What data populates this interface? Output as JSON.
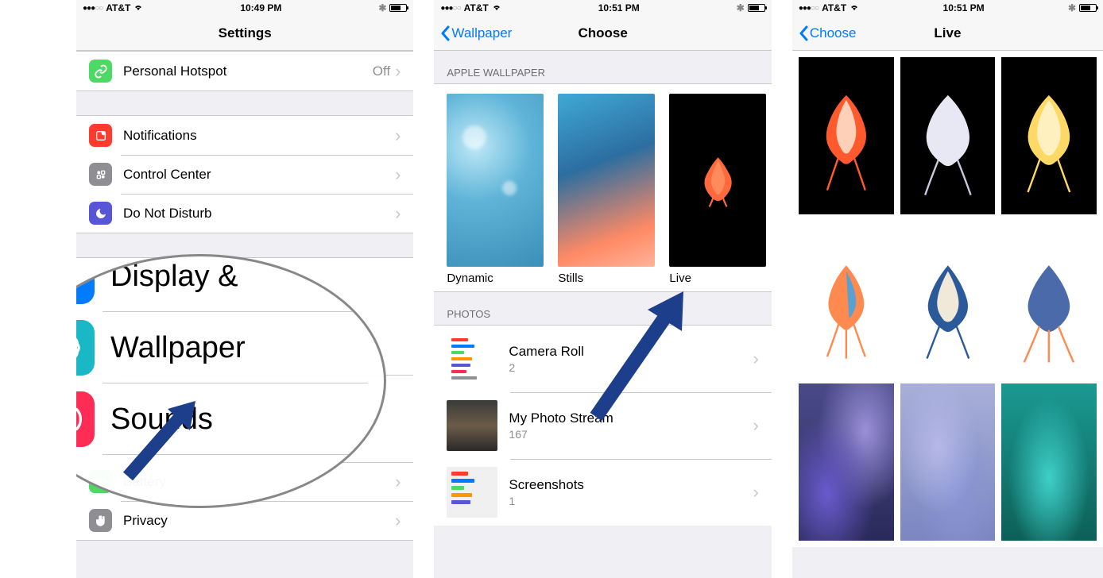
{
  "screen1": {
    "status": {
      "carrier": "AT&T",
      "time": "10:49 PM"
    },
    "title": "Settings",
    "hotspot": {
      "label": "Personal Hotspot",
      "value": "Off"
    },
    "notifications": "Notifications",
    "controlCenter": "Control Center",
    "dnd": "Do Not Disturb",
    "display": "Display &",
    "wallpaper": "Wallpaper",
    "sounds": "Sounds",
    "battery": "Battery",
    "privacy": "Privacy"
  },
  "screen2": {
    "status": {
      "carrier": "AT&T",
      "time": "10:51 PM"
    },
    "back": "Wallpaper",
    "title": "Choose",
    "sectionApple": "APPLE WALLPAPER",
    "dynamic": "Dynamic",
    "stills": "Stills",
    "live": "Live",
    "sectionPhotos": "PHOTOS",
    "cameraRoll": {
      "title": "Camera Roll",
      "count": "2"
    },
    "myStream": {
      "title": "My Photo Stream",
      "count": "167"
    },
    "screenshots": {
      "title": "Screenshots",
      "count": "1"
    }
  },
  "screen3": {
    "status": {
      "carrier": "AT&T",
      "time": "10:51 PM"
    },
    "back": "Choose",
    "title": "Live"
  }
}
